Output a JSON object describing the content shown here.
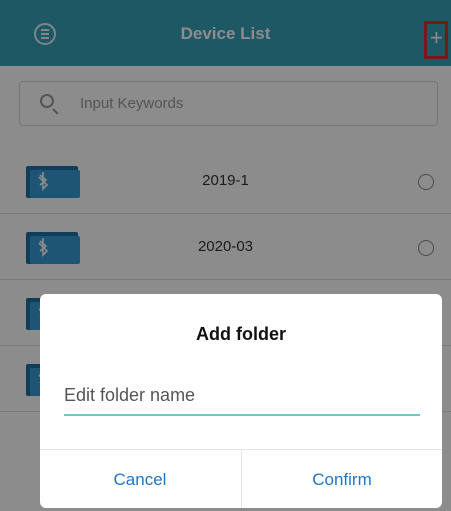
{
  "header": {
    "title": "Device List",
    "menu_icon": "menu-icon",
    "add_icon": "plus-icon",
    "accent_color": "#3aa0b8",
    "highlight_color": "#d72c2c"
  },
  "search": {
    "placeholder": "Input Keywords",
    "icon": "search-icon"
  },
  "list": {
    "items": [
      {
        "label": "2019-1",
        "icon": "bluetooth-folder-icon",
        "selected": false
      },
      {
        "label": "2020-03",
        "icon": "bluetooth-folder-icon",
        "selected": false
      },
      {
        "label": "",
        "icon": "bluetooth-folder-icon",
        "selected": false
      },
      {
        "label": "",
        "icon": "bluetooth-folder-icon",
        "selected": false
      }
    ]
  },
  "dialog": {
    "title": "Add folder",
    "input_placeholder": "Edit folder name",
    "input_value": "",
    "cancel_label": "Cancel",
    "confirm_label": "Confirm",
    "button_color": "#1e76c8",
    "underline_color": "#6fc9c9"
  }
}
